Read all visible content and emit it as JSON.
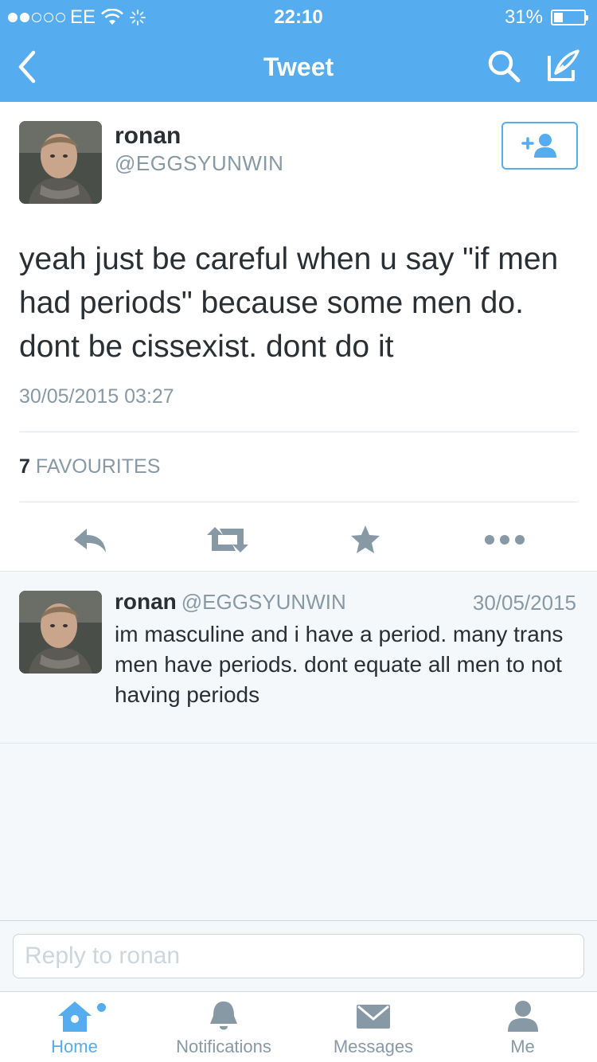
{
  "status_bar": {
    "carrier": "EE",
    "time": "22:10",
    "battery": "31%",
    "battery_level": 0.31
  },
  "nav": {
    "title": "Tweet",
    "back_icon": "chevron-left-icon",
    "search_icon": "search-icon",
    "compose_icon": "compose-icon"
  },
  "tweet": {
    "name": "ronan",
    "handle": "@EGGSYUNWIN",
    "text": "yeah just be careful when u say \"if men had periods\" because some men do. dont be cissexist. dont do it",
    "timestamp": "30/05/2015 03:27",
    "favourites_count": "7",
    "favourites_label": "FAVOURITES"
  },
  "reply_tweet": {
    "name": "ronan",
    "handle": "@EGGSYUNWIN",
    "date": "30/05/2015",
    "text": "im masculine and i have a period. many trans men have periods. dont equate all men to not having periods"
  },
  "reply_box": {
    "placeholder": "Reply to ronan"
  },
  "tabs": [
    {
      "label": "Home",
      "icon": "home-icon",
      "active": true
    },
    {
      "label": "Notifications",
      "icon": "bell-icon",
      "active": false
    },
    {
      "label": "Messages",
      "icon": "envelope-icon",
      "active": false
    },
    {
      "label": "Me",
      "icon": "person-icon",
      "active": false
    }
  ],
  "colors": {
    "brand": "#55acee",
    "text": "#292f33",
    "muted": "#8899a6",
    "icon": "#8899a6"
  }
}
